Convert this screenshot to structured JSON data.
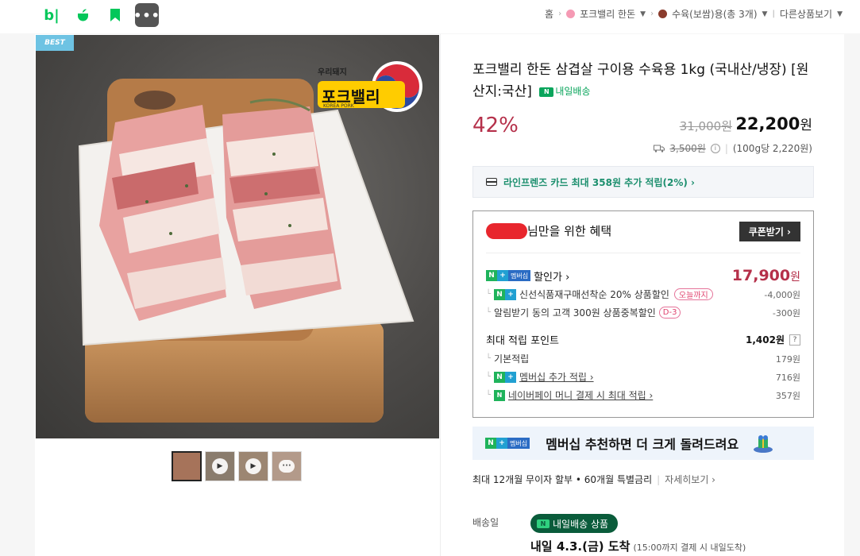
{
  "topbar": {
    "b_logo": "b|",
    "more": "•••",
    "breadcrumb": {
      "home": "홈",
      "store": "포크밸리 한돈",
      "category": "수육(보쌈)용(총 3개)",
      "other": "다른상품보기"
    }
  },
  "gallery": {
    "best_badge": "BEST",
    "logo_small": "우리돼지",
    "logo_main": "포크밸리",
    "logo_sub": "KOREA PORK"
  },
  "product": {
    "title": "포크밸리 한돈 삼겹살 구이용 수육용 1kg (국내산/냉장) [원산지:국산]",
    "delivery_badge": "내일배송",
    "discount_rate": "42%",
    "original_price": "31,000원",
    "price_number": "22,200",
    "price_unit": "원",
    "shipping_fee": "3,500원",
    "unit_price": "(100g당 2,220원)"
  },
  "card_promo": "라인프렌즈 카드 최대 358원 추가 적립(2%) ›",
  "benefit": {
    "title_suffix": "님만을 위한 혜택",
    "coupon_button": "쿠폰받기 ›",
    "membership_label": "멤버십",
    "discount_label": "할인가 ›",
    "discount_price": "17,900",
    "discount_unit": "원",
    "rows": [
      {
        "label": "신선식품재구매선착순 20% 상품할인",
        "pill": "오늘까지",
        "value": "-4,000원"
      },
      {
        "label": "알림받기 동의 고객 300원 상품중복할인",
        "pill": "D-3",
        "value": "-300원"
      }
    ],
    "points_label": "최대 적립 포인트",
    "points_value": "1,402원",
    "points_help": "?",
    "point_rows": [
      {
        "label": "기본적립",
        "value": "179원"
      },
      {
        "label": "멤버십 추가 적립 ›",
        "value": "716원"
      },
      {
        "label": "네이버페이 머니 결제 시 최대 적립 ›",
        "value": "357원"
      }
    ]
  },
  "membership_banner": {
    "label": "멤버십",
    "text": "멤버십 추천하면 더 크게 돌려드려요"
  },
  "installment": {
    "text": "최대 12개월 무이자 할부 • 60개월 특별금리",
    "more": "자세히보기 ›"
  },
  "delivery": {
    "label": "배송일",
    "badge": "내일배송 상품",
    "arrive_main": "내일 4.3.(금) 도착",
    "arrive_note": "(15:00까지 결제 시 내일도착)"
  },
  "colors": {
    "accent_red": "#b5304a",
    "naver_green": "#03c75a",
    "delivery_dark": "#0a5c3b"
  }
}
